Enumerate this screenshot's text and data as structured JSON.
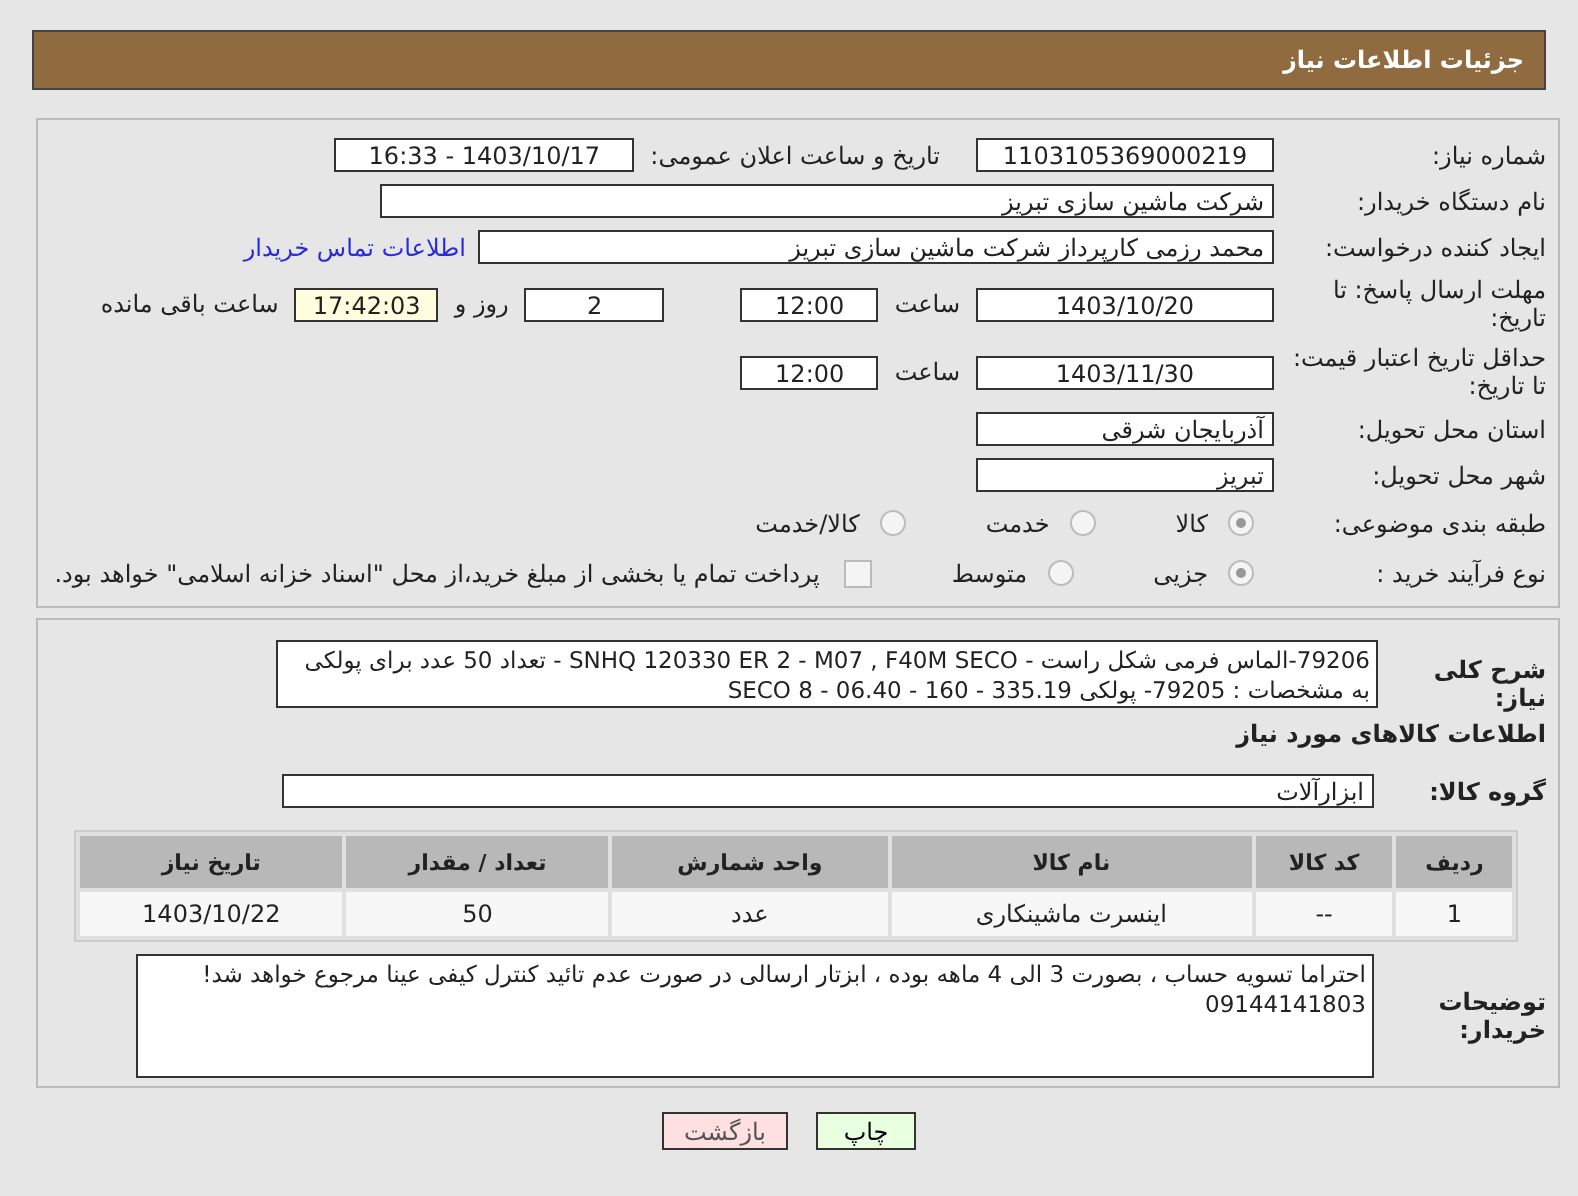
{
  "header": {
    "title": "جزئیات اطلاعات نیاز"
  },
  "need_number": {
    "label": "شماره نیاز:",
    "value": "1103105369000219"
  },
  "announce": {
    "label": "تاریخ و ساعت اعلان عمومی:",
    "value": "1403/10/17 - 16:33"
  },
  "buyer_org": {
    "label": "نام دستگاه خریدار:",
    "value": "شرکت ماشین سازی تبریز"
  },
  "requester": {
    "label": "ایجاد کننده درخواست:",
    "value": "محمد رزمی کارپرداز شرکت ماشین سازی تبریز",
    "link": "اطلاعات تماس خریدار"
  },
  "deadline": {
    "label": "مهلت ارسال پاسخ: تا تاریخ:",
    "date": "1403/10/20",
    "time_label": "ساعت",
    "time": "12:00",
    "days": "2",
    "days_label": "روز و",
    "remaining": "17:42:03",
    "remaining_label": "ساعت باقی مانده"
  },
  "validity": {
    "label": "حداقل تاریخ اعتبار قیمت: تا تاریخ:",
    "date": "1403/11/30",
    "time_label": "ساعت",
    "time": "12:00"
  },
  "province": {
    "label": "استان محل تحویل:",
    "value": "آذربایجان شرقی"
  },
  "city": {
    "label": "شهر محل تحویل:",
    "value": "تبریز"
  },
  "category": {
    "label": "طبقه بندی موضوعی:",
    "options": [
      {
        "label": "کالا",
        "selected": true
      },
      {
        "label": "خدمت",
        "selected": false
      },
      {
        "label": "کالا/خدمت",
        "selected": false
      }
    ]
  },
  "process": {
    "label": "نوع فرآیند خرید :",
    "options": [
      {
        "label": "جزیی",
        "selected": true
      },
      {
        "label": "متوسط",
        "selected": false
      }
    ],
    "treasury": {
      "checked": false,
      "label": "پرداخت تمام یا بخشی از مبلغ خرید،از محل \"اسناد خزانه اسلامی\" خواهد بود."
    }
  },
  "description": {
    "label": "شرح کلی نیاز:",
    "value": "79206-الماس فرمی شکل راست - SNHQ 120330 ER 2 - M07 , F40M  SECO - تعداد 50 عدد  برای پولکی به مشخصات : 79205- پولکی 335.19 - 160 - 06.40 - 8  SECO"
  },
  "items_heading": "اطلاعات کالاهای مورد نیاز",
  "goods_group": {
    "label": "گروه کالا:",
    "value": "ابزارآلات"
  },
  "table": {
    "columns": [
      "ردیف",
      "کد کالا",
      "نام کالا",
      "واحد شمارش",
      "تعداد / مقدار",
      "تاریخ نیاز"
    ],
    "rows": [
      [
        "1",
        "--",
        "اینسرت ماشینکاری",
        "عدد",
        "50",
        "1403/10/22"
      ]
    ]
  },
  "buyer_notes": {
    "label": "توضیحات خریدار:",
    "value": "احتراما تسویه حساب ، بصورت 3 الی 4 ماهه بوده ، ابزتار ارسالی در صورت عدم تائید کنترل کیفی عینا مرجوع خواهد شد! 09144141803"
  },
  "buttons": [
    {
      "kind": "print",
      "label": "چاپ"
    },
    {
      "kind": "back",
      "label": "بازگشت"
    }
  ]
}
